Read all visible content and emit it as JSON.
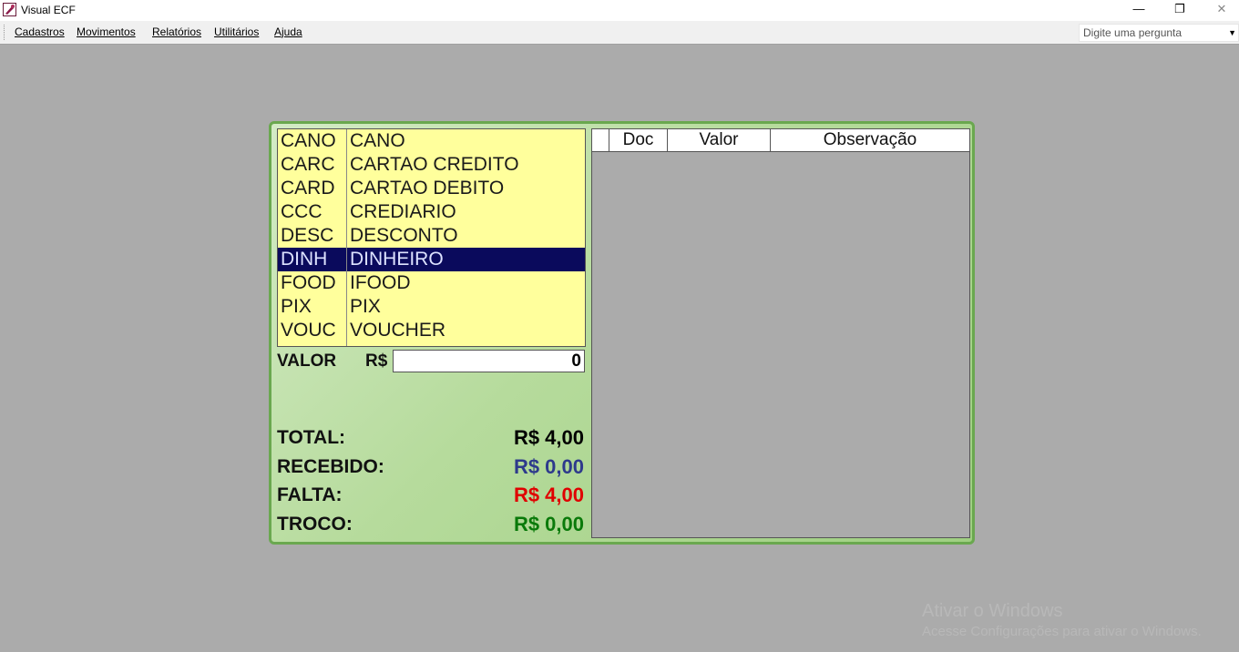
{
  "window": {
    "title": "Visual ECF",
    "minimize_glyph": "—",
    "restore_glyph": "❐",
    "close_glyph": "✕"
  },
  "menu": {
    "items": [
      "Cadastros",
      "Movimentos",
      "Relatórios",
      "Utilitários",
      "Ajuda"
    ],
    "ask_placeholder": "Digite uma pergunta"
  },
  "payments": [
    {
      "code": "CANO",
      "desc": "CANO"
    },
    {
      "code": "CARC",
      "desc": "CARTAO CREDITO"
    },
    {
      "code": "CARD",
      "desc": "CARTAO DEBITO"
    },
    {
      "code": "CCC",
      "desc": "CREDIARIO"
    },
    {
      "code": "DESC",
      "desc": "DESCONTO"
    },
    {
      "code": "DINH",
      "desc": "DINHEIRO"
    },
    {
      "code": "FOOD",
      "desc": "IFOOD"
    },
    {
      "code": "PIX",
      "desc": "PIX"
    },
    {
      "code": "VOUC",
      "desc": "VOUCHER"
    }
  ],
  "selected_payment": "DINH",
  "valor": {
    "label": "VALOR",
    "currency": "R$",
    "value": "0"
  },
  "summary": {
    "total_label": "TOTAL:",
    "total_value": "R$ 4,00",
    "recebido_label": "RECEBIDO:",
    "recebido_value": "R$ 0,00",
    "falta_label": "FALTA:",
    "falta_value": "R$ 4,00",
    "troco_label": "TROCO:",
    "troco_value": "R$ 0,00"
  },
  "colors": {
    "total": "#000000",
    "recebido": "#2e3a8c",
    "falta": "#e00000",
    "troco": "#0a7a0a"
  },
  "grid": {
    "columns": [
      "",
      "Doc",
      "Valor",
      "Observação"
    ]
  },
  "watermark": {
    "line1": "Ativar o Windows",
    "line2": "Acesse Configurações para ativar o Windows."
  }
}
